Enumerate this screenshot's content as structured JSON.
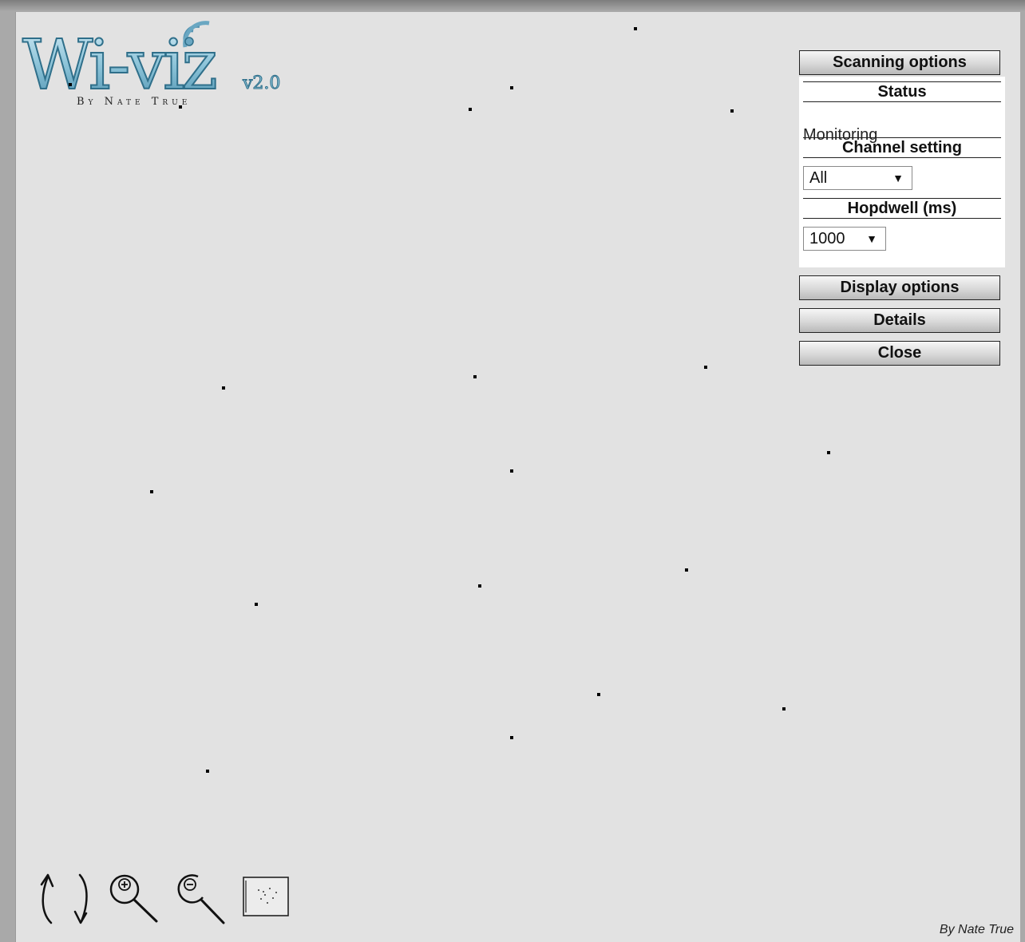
{
  "logo": {
    "title": "Wi-viz",
    "version": "v2.0",
    "byline": "By Nate True"
  },
  "panel": {
    "scanning_options_label": "Scanning options",
    "status_heading": "Status",
    "status_value": "Monitoring",
    "channel_heading": "Channel setting",
    "channel_value": "All",
    "hopdwell_heading": "Hopdwell (ms)",
    "hopdwell_value": "1000",
    "display_options_label": "Display options",
    "details_label": "Details",
    "close_label": "Close"
  },
  "toolbar": {
    "tools": [
      "rotate-left-icon",
      "rotate-right-icon",
      "zoom-in-icon",
      "zoom-out-icon",
      "fit-view-icon"
    ]
  },
  "footer": {
    "credit": "By Nate True"
  },
  "colors": {
    "canvas": "#e2e2e2",
    "logo_fill": "#7fb8cf",
    "logo_outline": "#2f6f8a",
    "node": "#000000"
  }
}
